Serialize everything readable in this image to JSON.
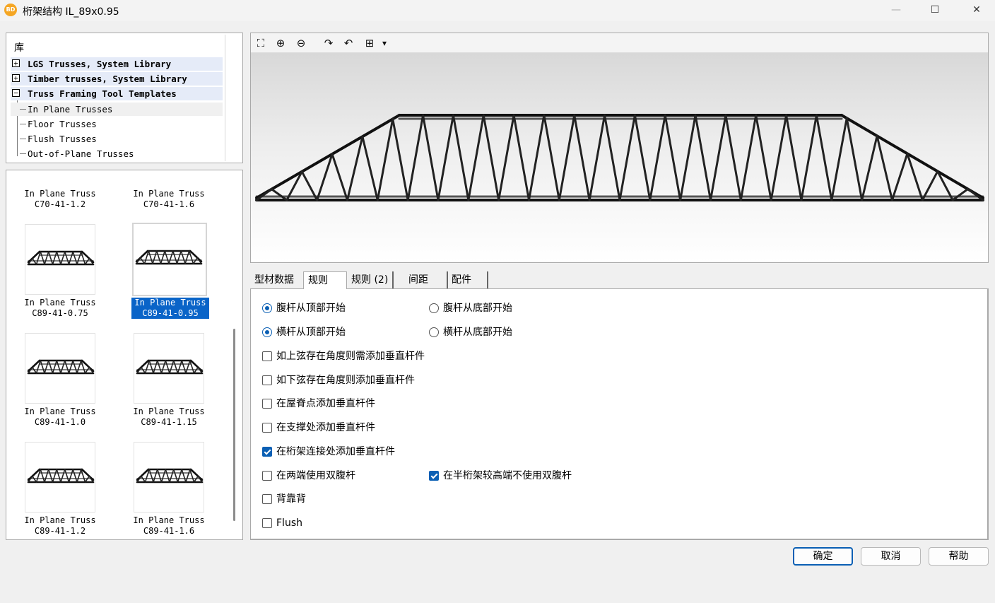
{
  "window": {
    "title": "桁架结构 IL_89x0.95",
    "app_icon_text": "BD",
    "controls": {
      "minimize": "—",
      "maximize": "☐",
      "close": "✕"
    }
  },
  "library": {
    "header": "库",
    "items": [
      {
        "label": "LGS Trusses, System Library",
        "level": 0,
        "expander": "+"
      },
      {
        "label": "Timber trusses, System Library",
        "level": 0,
        "expander": "+"
      },
      {
        "label": "Truss Framing Tool Templates",
        "level": 0,
        "expander": "−"
      },
      {
        "label": "In Plane Trusses",
        "level": 1,
        "selected": true
      },
      {
        "label": "Floor Trusses",
        "level": 1
      },
      {
        "label": "Flush Trusses",
        "level": 1
      },
      {
        "label": "Out-of-Plane Trusses",
        "level": 1
      }
    ]
  },
  "thumbnails": [
    {
      "line1": "In Plane Truss",
      "line2": "C70-41-1.2",
      "partial": true
    },
    {
      "line1": "In Plane Truss",
      "line2": "C70-41-1.6",
      "partial": true
    },
    {
      "line1": "In Plane Truss",
      "line2": "C89-41-0.75"
    },
    {
      "line1": "In Plane Truss",
      "line2": "C89-41-0.95",
      "selected": true
    },
    {
      "line1": "In Plane Truss",
      "line2": "C89-41-1.0"
    },
    {
      "line1": "In Plane Truss",
      "line2": "C89-41-1.15"
    },
    {
      "line1": "In Plane Truss",
      "line2": "C89-41-1.2"
    },
    {
      "line1": "In Plane Truss",
      "line2": "C89-41-1.6"
    }
  ],
  "preview_toolbar": {
    "icons": [
      "zoom-extents-icon",
      "zoom-in-icon",
      "zoom-out-icon",
      "rotate-left-icon",
      "rotate-right-icon",
      "pan-icon",
      "dropdown-arrow-icon"
    ],
    "glyphs": [
      "⛶",
      "⊕",
      "⊖",
      "↷",
      "↶",
      "⊞",
      "▾"
    ]
  },
  "tabs": [
    {
      "label": "型材数据"
    },
    {
      "label": "规则",
      "active": true
    },
    {
      "label": "规则 (2)"
    },
    {
      "label": "间距"
    },
    {
      "label": "配件"
    }
  ],
  "rules": {
    "web_from_top": {
      "label": "腹杆从顶部开始",
      "checked": true
    },
    "web_from_bottom": {
      "label": "腹杆从底部开始",
      "checked": false
    },
    "bar_from_top": {
      "label": "横杆从顶部开始",
      "checked": true
    },
    "bar_from_bottom": {
      "label": "横杆从底部开始",
      "checked": false
    },
    "checkboxes": [
      {
        "label": "如上弦存在角度则需添加垂直杆件",
        "checked": false
      },
      {
        "label": "如下弦存在角度则添加垂直杆件",
        "checked": false
      },
      {
        "label": "在屋脊点添加垂直杆件",
        "checked": false
      },
      {
        "label": "在支撑处添加垂直杆件",
        "checked": false
      },
      {
        "label": "在桁架连接处添加垂直杆件",
        "checked": true
      },
      {
        "label": "在两端使用双腹杆",
        "checked": false
      },
      {
        "label": "背靠背",
        "checked": false
      },
      {
        "label": "Flush",
        "checked": false
      }
    ],
    "half_truss_no_double": {
      "label": "在半桁架较高端不使用双腹杆",
      "checked": true
    }
  },
  "buttons": {
    "ok": "确定",
    "cancel": "取消",
    "help": "帮助"
  },
  "colors": {
    "accent": "#0a5fb4",
    "selection": "#0a64c8",
    "tree_highlight": "#e5ebf8"
  }
}
